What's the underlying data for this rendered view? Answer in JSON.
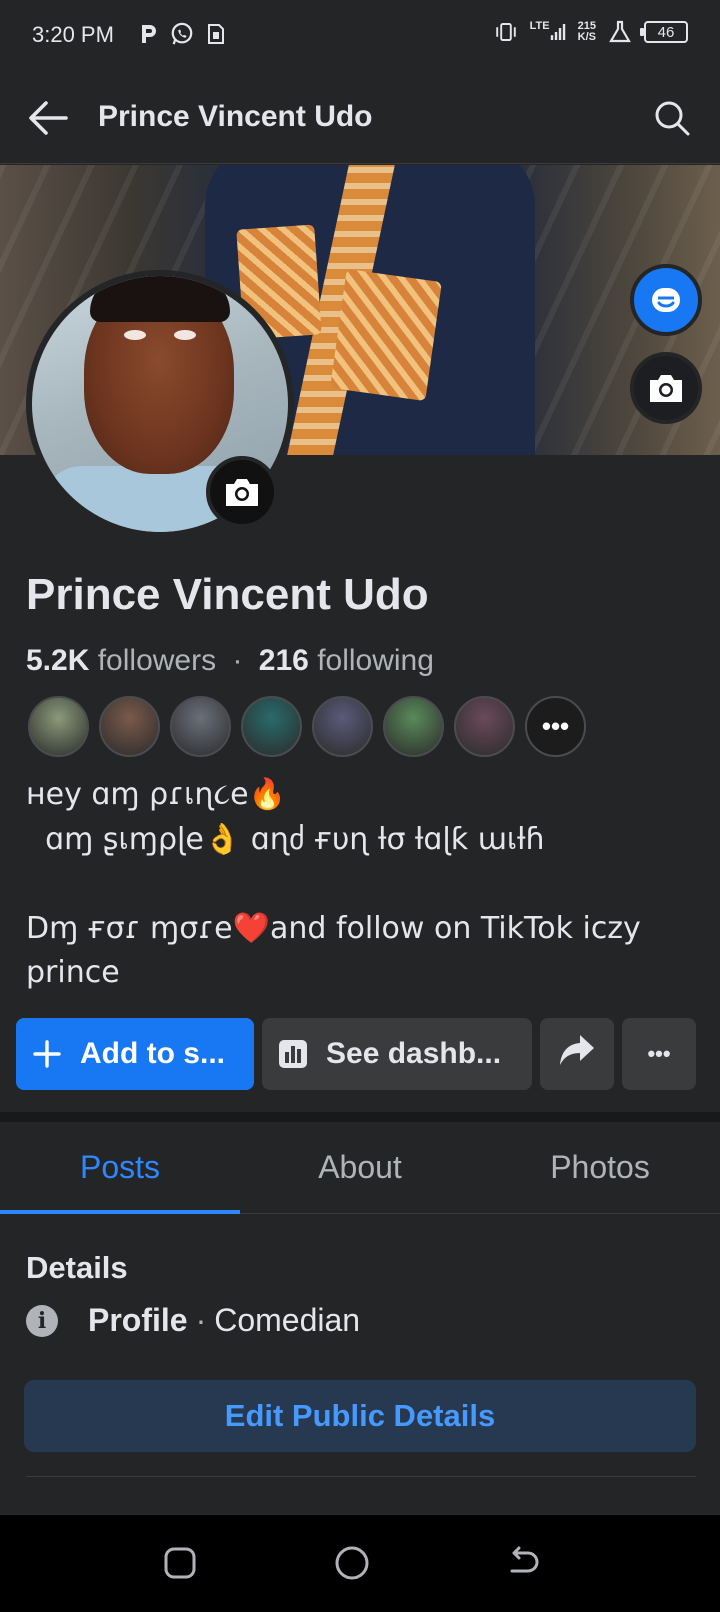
{
  "status_bar": {
    "time": "3:20 PM",
    "network_type": "LTE",
    "speed_value": "215",
    "speed_unit": "K/S",
    "battery": "46",
    "icons": [
      "p-notification-icon",
      "whatsapp-icon",
      "sim-card-icon",
      "vibrate-icon",
      "signal-icon",
      "flask-icon"
    ]
  },
  "header": {
    "title": "Prince Vincent Udo"
  },
  "profile": {
    "name": "Prince Vincent Udo",
    "followers_count": "5.2K",
    "followers_label": "followers",
    "separator": "·",
    "following_count": "216",
    "following_label": "following",
    "bio_line1": "ʜey ɑɱ ρɾเɳ૮e🔥",
    "bio_line2": "  ɑɱ ʂเɱρɭe👌 ɑɳძ ғυɳ ƚσ ƚɑɭƙ ɯเƚɦ",
    "bio_line3": "Dɱ ғσɾ ɱσɾe❤️and follow on TikTok iczy prince"
  },
  "friends": {
    "more_label": "•••",
    "colors": [
      "#8a9a7a",
      "#7a5a4a",
      "#6a6f7a",
      "#2a6a6a",
      "#5a5a7a",
      "#5a8a5a",
      "#6a4a5a"
    ]
  },
  "actions": {
    "add_story": "Add to s...",
    "dashboard": "See dashb...",
    "more": "•••"
  },
  "tabs": [
    {
      "label": "Posts"
    },
    {
      "label": "About"
    },
    {
      "label": "Photos"
    }
  ],
  "details": {
    "title": "Details",
    "profile_label": "Profile",
    "separator": "·",
    "profile_value": "Comedian",
    "info_glyph": "i",
    "edit_button": "Edit Public Details"
  },
  "colors": {
    "accent": "#1877f2",
    "tab_active": "#2d88ff",
    "background": "#242526"
  }
}
